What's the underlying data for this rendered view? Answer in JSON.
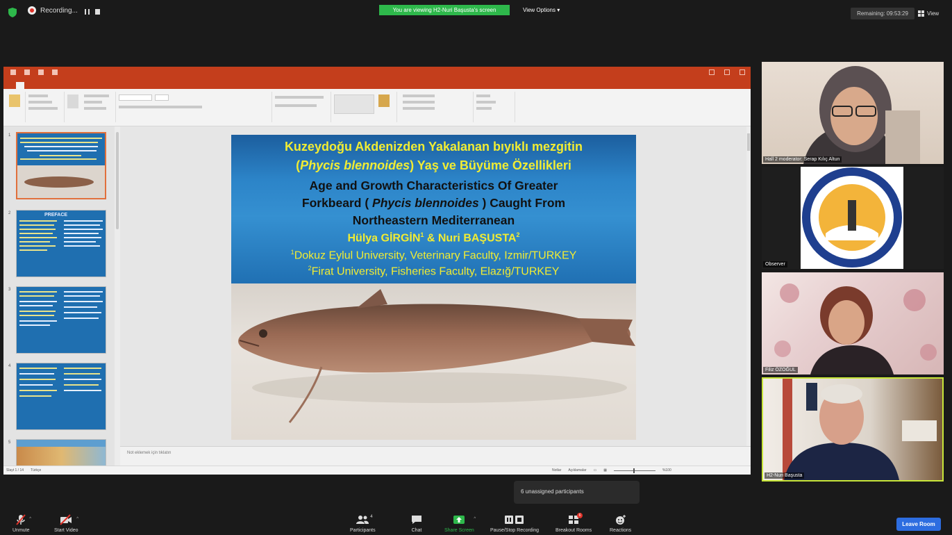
{
  "topbar": {
    "recording_label": "Recording...",
    "viewing_banner": "You are viewing H2-Nuri Başusta's screen",
    "view_options_label": "View Options",
    "remaining": "Remaining: 09:53:29",
    "view_label": "View"
  },
  "slide": {
    "title_tr_line1": "Kuzeydoğu Akdenizden Yakalanan bıyıklı mezgitin",
    "title_tr_line2_pre": "(",
    "title_tr_line2_italic": "Phycis blennoides",
    "title_tr_line2_post": ") Yaş ve Büyüme Özellikleri",
    "title_en_line1": "Age and Growth Characteristics Of Greater",
    "title_en_line2_pre": "Forkbeard ( ",
    "title_en_line2_italic": "Phycis blennoides",
    "title_en_line2_post": " ) Caught From",
    "title_en_line3": "Northeastern Mediterranean",
    "author1": "Hülya GİRGİN",
    "author_sep": " & ",
    "author2": "Nuri BAŞUSTA",
    "sup1": "1",
    "sup2": "2",
    "affiliation1": "Dokuz Eylul University, Veterinary Faculty, Izmir/TURKEY",
    "affiliation2": "Firat University, Fisheries Faculty, Elazığ/TURKEY"
  },
  "ppt": {
    "thumb_numbers": [
      "1",
      "2",
      "3",
      "4",
      "5"
    ],
    "thumb2_title": "PREFACE",
    "notes_placeholder": "Not eklemek için tıklatın",
    "status_slide": "Slayt 1 / 14",
    "status_lang": "Türkçe",
    "status_notes": "Notlar",
    "status_comments": "Açıklamalar",
    "status_zoom": "%100"
  },
  "participants": [
    {
      "name": "Hall 2 moderator: Serap Kılıç Altun"
    },
    {
      "name": "Observer"
    },
    {
      "name": "Filiz ÖZOĞUL"
    },
    {
      "name": "H2-Nuri Başusta"
    }
  ],
  "popup": {
    "text": "6 unassigned participants"
  },
  "toolbar": {
    "unmute": "Unmute",
    "start_video": "Start Video",
    "participants": "Participants",
    "participants_count": "4",
    "chat": "Chat",
    "share_screen": "Share Screen",
    "pause_recording": "Pause/Stop Recording",
    "breakout_rooms": "Breakout Rooms",
    "breakout_badge": "6",
    "reactions": "Reactions",
    "leave": "Leave Room"
  },
  "colors": {
    "ppt_accent": "#c43e1c",
    "slide_yellow": "#f1ec33",
    "zoom_green": "#2eb84b",
    "leave_blue": "#2d6de0",
    "active_speaker": "#c8e639"
  }
}
